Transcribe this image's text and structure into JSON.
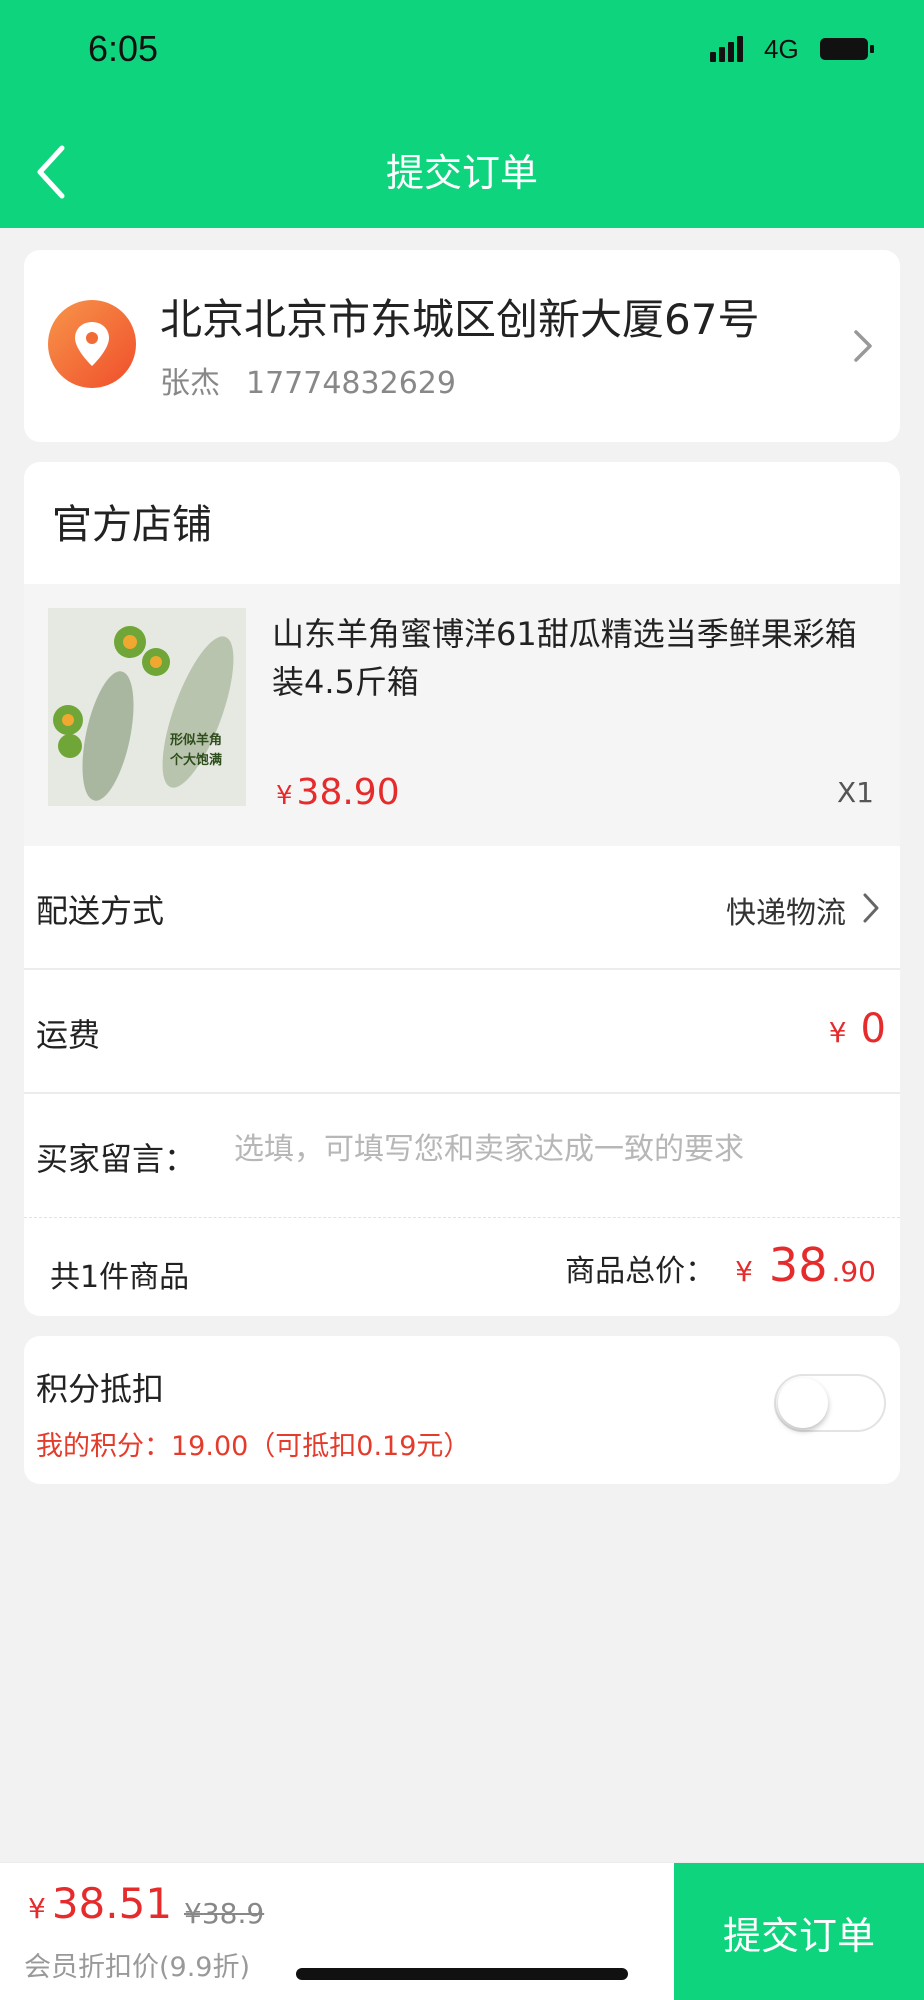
{
  "status_bar": {
    "time": "6:05",
    "network": "4G"
  },
  "nav": {
    "title": "提交订单",
    "back_icon": "chevron-left-icon"
  },
  "address": {
    "icon": "location-pin-icon",
    "line": "北京北京市东城区创新大厦67号",
    "name": "张杰",
    "phone": "17774832629"
  },
  "shop": {
    "name": "官方店铺"
  },
  "product": {
    "name": "山东羊角蜜博洋61甜瓜精选当季鲜果彩箱装4.5斤箱",
    "image_caption": "形似羊角\n个大饱满",
    "price_symbol": "¥",
    "price": "38.90",
    "quantity": "X1"
  },
  "delivery": {
    "label": "配送方式",
    "value": "快递物流"
  },
  "shipping": {
    "label": "运费",
    "symbol": "¥",
    "value": "0"
  },
  "message": {
    "label": "买家留言：",
    "placeholder": "选填，可填写您和卖家达成一致的要求",
    "value": ""
  },
  "summary": {
    "count_text": "共1件商品",
    "total_label": "商品总价：",
    "symbol": "¥",
    "total_int": "38",
    "total_dec": ".90"
  },
  "points": {
    "title": "积分抵扣",
    "detail": "我的积分：19.00（可抵扣0.19元）",
    "enabled": false
  },
  "bottom_bar": {
    "symbol": "¥",
    "final_price": "38.51",
    "original_price": "¥38.9",
    "member_note": "会员折扣价(9.9折)",
    "submit_label": "提交订单"
  },
  "colors": {
    "brand_green": "#0fd47e",
    "price_red": "#e52b2b",
    "pin_orange": "#f26a35"
  }
}
